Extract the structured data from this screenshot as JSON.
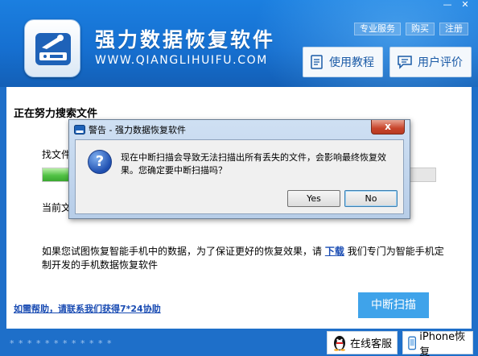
{
  "app": {
    "title": "强力数据恢复软件",
    "url": "WWW.QIANGLIHUIFU.COM",
    "window_buttons": [
      "—",
      "✕"
    ],
    "top_links": [
      "专业服务",
      "购买",
      "注册"
    ],
    "tutorial_label": "使用教程",
    "review_label": "用户评价"
  },
  "main": {
    "section_title": "正在努力搜索文件",
    "file_label": "找文件",
    "progress": 0.12,
    "current_label": "当前文",
    "tip_text": "如果您试图恢复智能手机中的数据，为了保证更好的恢复效果，请",
    "tip_link": "下载",
    "tip_text2": "我们专门为智能手机定制开发的手机数据恢复软件",
    "help_link": "如需帮助，请联系我们获得7*24协助",
    "stop_button": "中断扫描"
  },
  "footer": {
    "version": "* * * * * * * * * * * *",
    "online_service": "在线客服",
    "iphone_recovery": "iPhone恢复"
  },
  "dialog": {
    "title": "警告 - 强力数据恢复软件",
    "icon": "question-icon",
    "message": "现在中断扫描会导致无法扫描出所有丢失的文件，会影响最终恢复效果。您确定要中断扫描吗？",
    "yes_label": "Yes",
    "no_label": "No",
    "close_label": "x"
  },
  "colors": {
    "brand_blue": "#1670d1",
    "stop_button": "#3fa3ea",
    "link": "#1a4cb3",
    "progress_green": "#52c245"
  }
}
